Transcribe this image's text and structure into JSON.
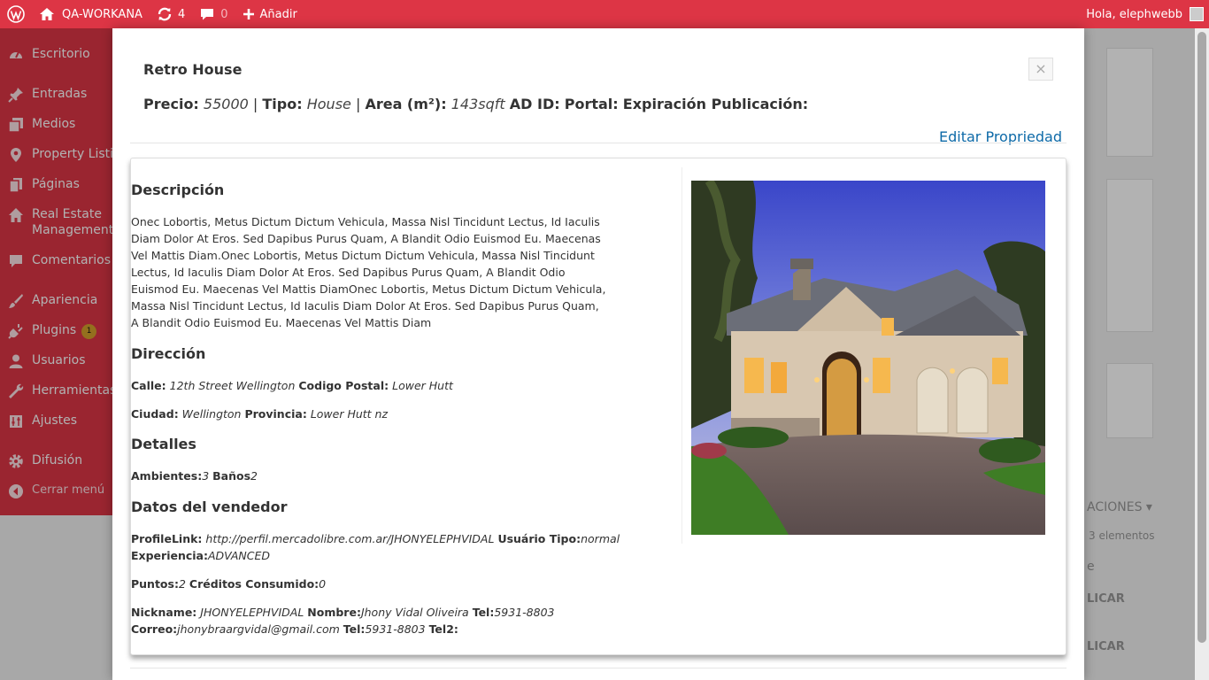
{
  "adminbar": {
    "site_name": "QA-WORKANA",
    "updates_count": "4",
    "comments_count": "0",
    "new_label": "Añadir",
    "greeting": "Hola, elephwebb"
  },
  "sidebar": {
    "items": [
      {
        "label": "Escritorio",
        "icon": "dashboard-icon"
      },
      {
        "label": "Entradas",
        "icon": "pin-icon"
      },
      {
        "label": "Medios",
        "icon": "media-icon"
      },
      {
        "label": "Property Listin",
        "icon": "location-icon"
      },
      {
        "label": "Páginas",
        "icon": "pages-icon"
      },
      {
        "label": "Real Estate",
        "label2": "Management",
        "icon": "home-icon"
      },
      {
        "label": "Comentarios",
        "icon": "comment-icon"
      },
      {
        "label": "Apariencia",
        "icon": "appearance-icon"
      },
      {
        "label": "Plugins",
        "badge": "1",
        "icon": "plugin-icon"
      },
      {
        "label": "Usuarios",
        "icon": "user-icon"
      },
      {
        "label": "Herramientas",
        "icon": "tools-icon"
      },
      {
        "label": "Ajustes",
        "icon": "settings-icon"
      },
      {
        "label": "Difusión",
        "icon": "gear-icon"
      },
      {
        "label": "Cerrar menú",
        "icon": "collapse-icon"
      }
    ]
  },
  "background": {
    "dropdown_label": "ACIONES",
    "count_label": "3 elementos",
    "row_text": "e",
    "publish_1": "LICAR",
    "publish_2": "LICAR"
  },
  "modal": {
    "title": "Retro House",
    "close_label": "×",
    "meta": {
      "price_label": "Precio:",
      "price_value": "55000",
      "type_label": "Tipo:",
      "type_value": "House",
      "area_label": "Area (m²):",
      "area_value": "143sqft",
      "ad_label": "AD ID:",
      "portal_label": "Portal:",
      "expiry_label": "Expiración Publicación:"
    },
    "edit_link": "Editar Propriedad",
    "description_heading": "Descripción",
    "description": "Onec Lobortis, Metus Dictum Dictum Vehicula, Massa Nisl Tincidunt Lectus, Id Iaculis Diam Dolor At Eros. Sed Dapibus Purus Quam, A Blandit Odio Euismod Eu. Maecenas Vel Mattis Diam.Onec Lobortis, Metus Dictum Dictum Vehicula, Massa Nisl Tincidunt Lectus, Id Iaculis Diam Dolor At Eros. Sed Dapibus Purus Quam, A Blandit Odio Euismod Eu. Maecenas Vel Mattis DiamOnec Lobortis, Metus Dictum Dictum Vehicula, Massa Nisl Tincidunt Lectus, Id Iaculis Diam Dolor At Eros. Sed Dapibus Purus Quam, A Blandit Odio Euismod Eu. Maecenas Vel Mattis Diam",
    "address_heading": "Dirección",
    "street_label": "Calle:",
    "street_value": "12th Street Wellington",
    "postal_label": "Codigo Postal:",
    "postal_value": "Lower Hutt",
    "city_label": "Ciudad:",
    "city_value": "Wellington",
    "province_label": "Provincia:",
    "province_value": "Lower Hutt nz",
    "details_heading": "Detalles",
    "rooms_label": "Ambientes:",
    "rooms_value": "3",
    "baths_label": "Baños",
    "baths_value": "2",
    "seller_heading": "Datos del vendedor",
    "profile_label": "ProfileLink:",
    "profile_value": "http://perfil.mercadolibre.com.ar/JHONYELEPHVIDAL",
    "usertype_label": "Usuário Tipo:",
    "usertype_value": "normal",
    "experience_label": "Experiencia:",
    "experience_value": "ADVANCED",
    "points_label": "Puntos:",
    "points_value": "2",
    "credits_label": "Créditos Consumido:",
    "credits_value": "0",
    "nickname_label": "Nickname:",
    "nickname_value": "JHONYELEPHVIDAL",
    "name_label": "Nombre:",
    "name_value": "Jhony Vidal Oliveira",
    "tel_label": "Tel:",
    "tel_value": "5931-8803",
    "email_label": "Correo:",
    "email_value": "jhonybraargvidal@gmail.com",
    "tel_label_2": "Tel:",
    "tel_value_2": "5931-8803",
    "tel2_label": "Tel2:"
  },
  "colors": {
    "admin_red": "#dd3545",
    "link_blue": "#0e6aa8",
    "badge": "#d5a12c"
  }
}
